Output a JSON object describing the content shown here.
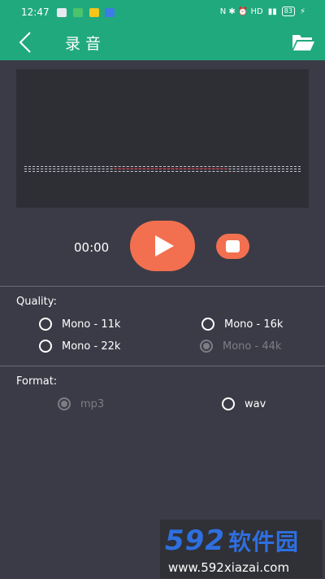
{
  "status_bar": {
    "time": "12:47",
    "right_text": "N ✱ ⏰ HD",
    "battery": "83"
  },
  "toolbar": {
    "title": "录音",
    "accent_color": "#21a97e"
  },
  "player": {
    "timer": "00:00",
    "button_color": "#f2704f"
  },
  "quality": {
    "label": "Quality:",
    "options": [
      {
        "label": "Mono - 11k",
        "checked": false,
        "enabled": true
      },
      {
        "label": "Mono - 16k",
        "checked": false,
        "enabled": true
      },
      {
        "label": "Mono - 22k",
        "checked": false,
        "enabled": true
      },
      {
        "label": "Mono - 44k",
        "checked": true,
        "enabled": false
      }
    ]
  },
  "format": {
    "label": "Format:",
    "options": [
      {
        "label": "mp3",
        "checked": true,
        "enabled": false
      },
      {
        "label": "wav",
        "checked": false,
        "enabled": true
      }
    ]
  },
  "watermark": {
    "logo_number": "592",
    "logo_text": "软件园",
    "url": "www.592xiazai.com"
  }
}
